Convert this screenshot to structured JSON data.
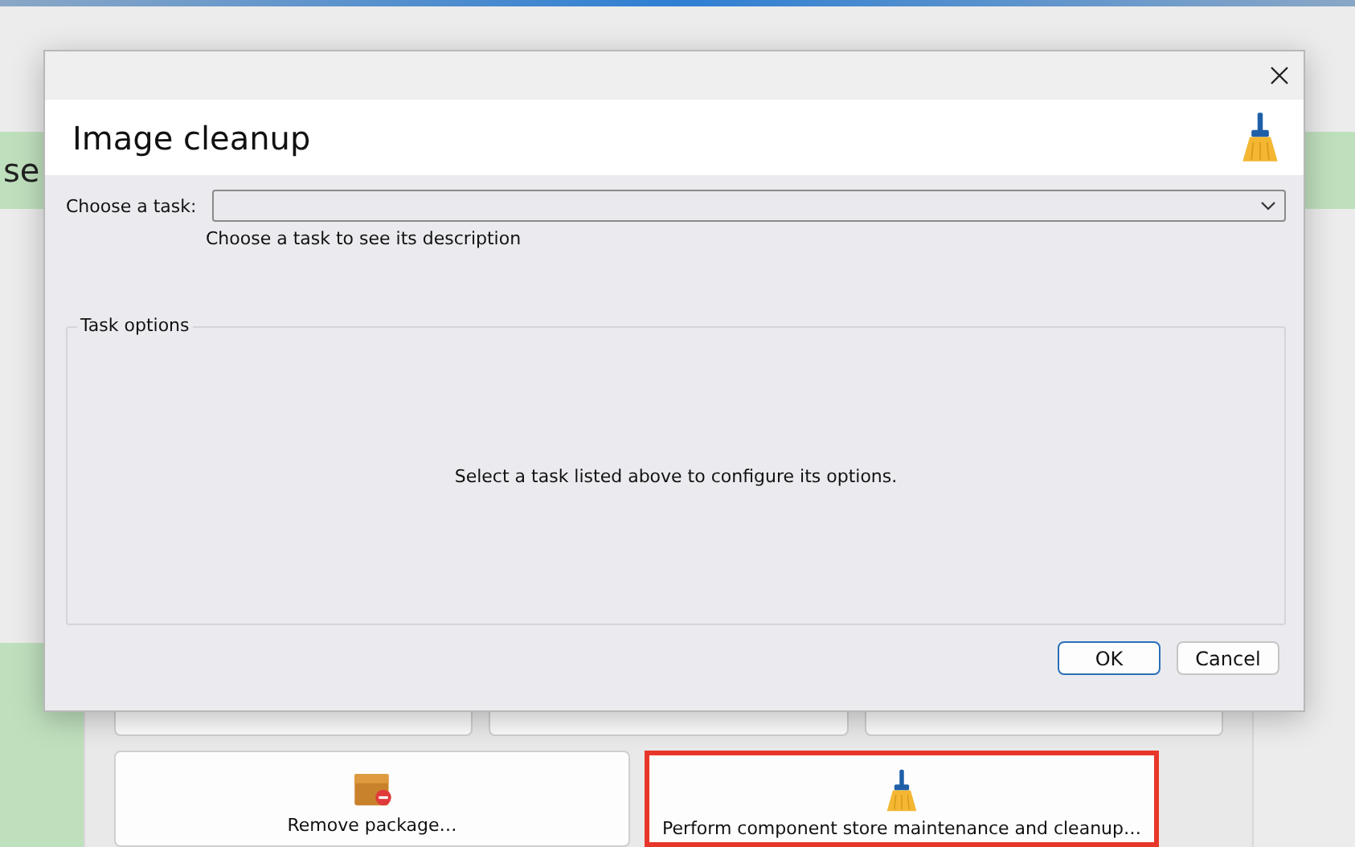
{
  "background": {
    "banner_text": "se",
    "covered_buttons": [
      {
        "kind": "covered"
      },
      {
        "kind": "covered"
      },
      {
        "kind": "covered"
      }
    ],
    "buttons": [
      {
        "label": "Remove package…",
        "kind": "remove",
        "highlighted": false
      },
      {
        "label": "Perform component store maintenance and cleanup…",
        "kind": "cleanup",
        "highlighted": true
      }
    ]
  },
  "dialog": {
    "title": "Image cleanup",
    "task_label": "Choose a task:",
    "description": "Choose a task to see its description",
    "group": {
      "title": "Task options",
      "message": "Select a task listed above to configure its options."
    },
    "buttons": [
      {
        "label": "OK",
        "default": true
      },
      {
        "label": "Cancel",
        "default": false
      }
    ]
  }
}
